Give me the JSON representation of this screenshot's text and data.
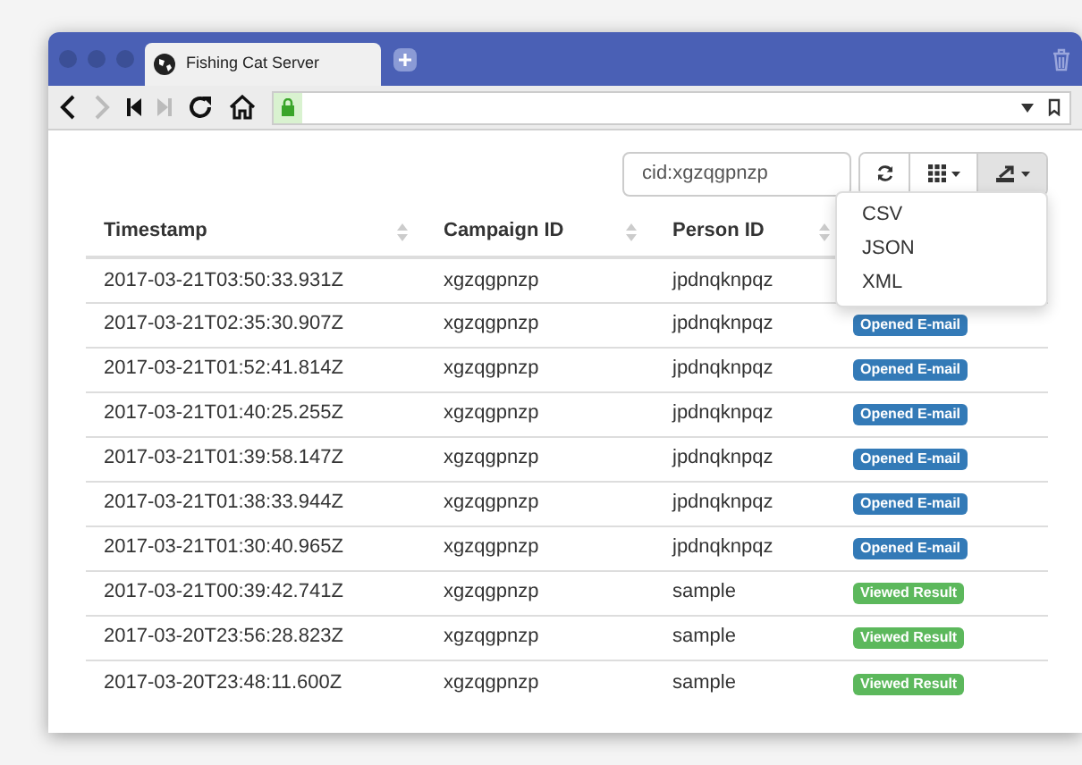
{
  "window": {
    "tab_title": "Fishing Cat Server"
  },
  "filter": {
    "value": "cid:xgzqgpnzp"
  },
  "export_menu": {
    "expanded": true,
    "items": [
      "CSV",
      "JSON",
      "XML"
    ]
  },
  "table": {
    "columns": [
      "Timestamp",
      "Campaign ID",
      "Person ID"
    ],
    "rows": [
      {
        "timestamp": "2017-03-21T03:50:33.931Z",
        "campaign_id": "xgzqgpnzp",
        "person_id": "jpdnqknpqz"
      },
      {
        "timestamp": "2017-03-21T02:35:30.907Z",
        "campaign_id": "xgzqgpnzp",
        "person_id": "jpdnqknpqz",
        "event": {
          "kind": "opened",
          "label": "Opened E-mail"
        }
      },
      {
        "timestamp": "2017-03-21T01:52:41.814Z",
        "campaign_id": "xgzqgpnzp",
        "person_id": "jpdnqknpqz",
        "event": {
          "kind": "opened",
          "label": "Opened E-mail"
        }
      },
      {
        "timestamp": "2017-03-21T01:40:25.255Z",
        "campaign_id": "xgzqgpnzp",
        "person_id": "jpdnqknpqz",
        "event": {
          "kind": "opened",
          "label": "Opened E-mail"
        }
      },
      {
        "timestamp": "2017-03-21T01:39:58.147Z",
        "campaign_id": "xgzqgpnzp",
        "person_id": "jpdnqknpqz",
        "event": {
          "kind": "opened",
          "label": "Opened E-mail"
        }
      },
      {
        "timestamp": "2017-03-21T01:38:33.944Z",
        "campaign_id": "xgzqgpnzp",
        "person_id": "jpdnqknpqz",
        "event": {
          "kind": "opened",
          "label": "Opened E-mail"
        }
      },
      {
        "timestamp": "2017-03-21T01:30:40.965Z",
        "campaign_id": "xgzqgpnzp",
        "person_id": "jpdnqknpqz",
        "event": {
          "kind": "opened",
          "label": "Opened E-mail"
        }
      },
      {
        "timestamp": "2017-03-21T00:39:42.741Z",
        "campaign_id": "xgzqgpnzp",
        "person_id": "sample",
        "event": {
          "kind": "viewed",
          "label": "Viewed Result"
        }
      },
      {
        "timestamp": "2017-03-20T23:56:28.823Z",
        "campaign_id": "xgzqgpnzp",
        "person_id": "sample",
        "event": {
          "kind": "viewed",
          "label": "Viewed Result"
        }
      },
      {
        "timestamp": "2017-03-20T23:48:11.600Z",
        "campaign_id": "xgzqgpnzp",
        "person_id": "sample",
        "event": {
          "kind": "viewed",
          "label": "Viewed Result"
        }
      }
    ]
  }
}
